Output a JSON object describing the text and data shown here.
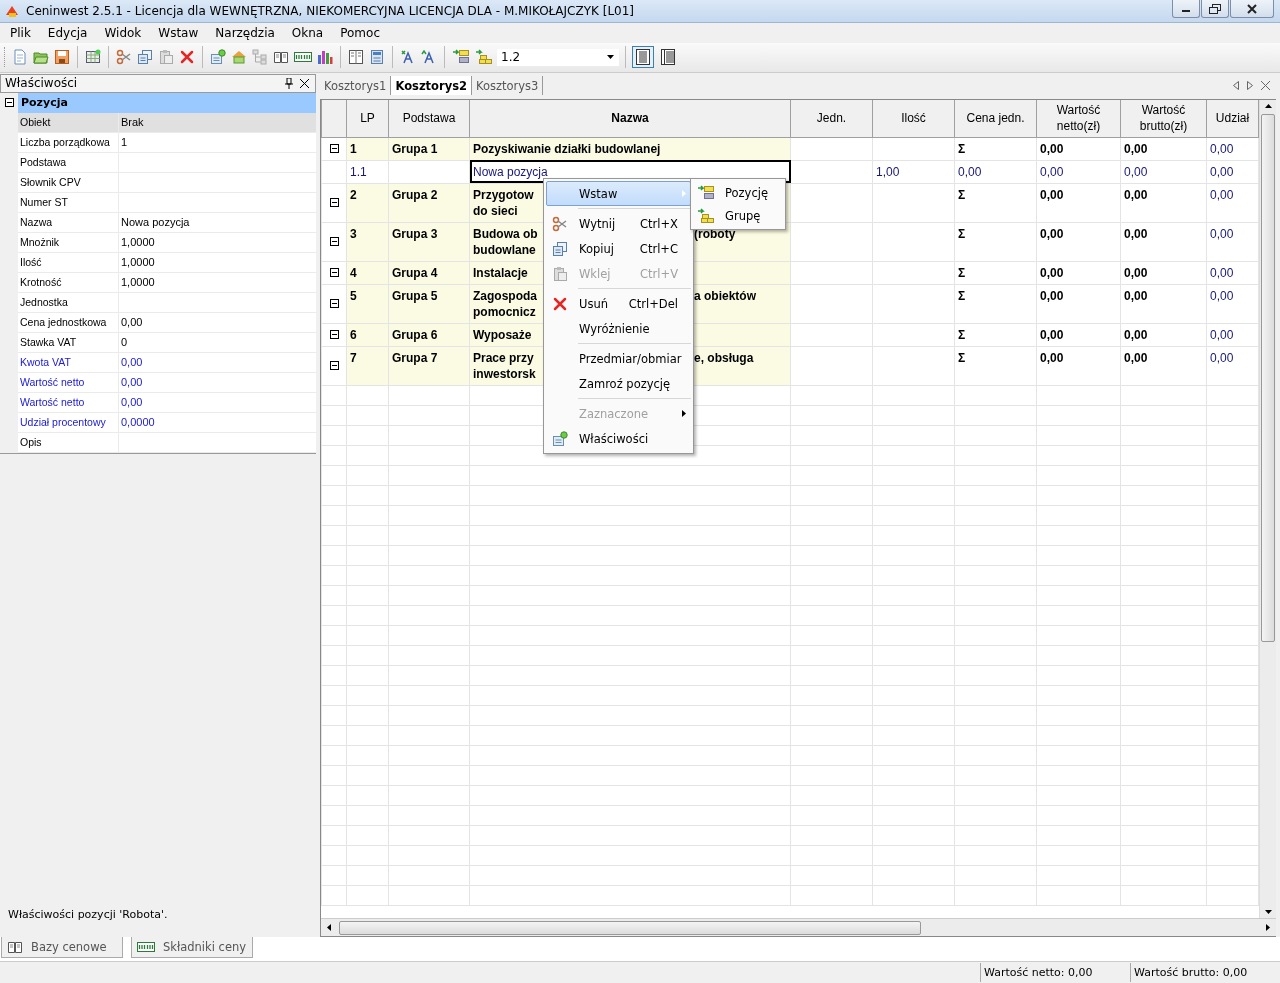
{
  "window": {
    "title": "Ceninwest 2.5.1 - Licencja dla WEWNĘTRZNA, NIEKOMERCYJNA LICENCJA DLA - M.MIKOŁAJCZYK [L01]"
  },
  "menu": [
    "Plik",
    "Edycja",
    "Widok",
    "Wstaw",
    "Narzędzia",
    "Okna",
    "Pomoc"
  ],
  "toolbar": {
    "level_combo": "1.2",
    "view_buttons": [
      {
        "selected": true
      },
      {
        "selected": false
      }
    ]
  },
  "properties_panel": {
    "title": "Właściwości",
    "category": {
      "label": "Pozycja",
      "expanded": true
    },
    "rows": [
      {
        "label": "Obiekt",
        "value": "Brak",
        "selected": true,
        "computed": false
      },
      {
        "label": "Liczba porządkowa",
        "value": "1",
        "selected": false,
        "computed": false
      },
      {
        "label": "Podstawa",
        "selected": false,
        "computed": false
      },
      {
        "label": "Słownik CPV",
        "selected": false,
        "computed": false
      },
      {
        "label": "Numer ST",
        "selected": false,
        "computed": false
      },
      {
        "label": "Nazwa",
        "value": "Nowa pozycja",
        "selected": false,
        "computed": false
      },
      {
        "label": "Mnożnik",
        "value": "1,0000",
        "selected": false,
        "computed": false
      },
      {
        "label": "Ilość",
        "value": "1,0000",
        "selected": false,
        "computed": false
      },
      {
        "label": "Krotność",
        "value": "1,0000",
        "selected": false,
        "computed": false
      },
      {
        "label": "Jednostka",
        "selected": false,
        "computed": false
      },
      {
        "label": "Cena jednostkowa",
        "value": "0,00",
        "selected": false,
        "computed": false
      },
      {
        "label": "Stawka VAT",
        "value": "0",
        "selected": false,
        "computed": false
      },
      {
        "label": "Kwota VAT",
        "value": "0,00",
        "selected": false,
        "computed": true
      },
      {
        "label": "Wartość netto",
        "value": "0,00",
        "selected": false,
        "computed": true
      },
      {
        "label": "Wartość netto",
        "value": "0,00",
        "selected": false,
        "computed": true
      },
      {
        "label": "Udział procentowy",
        "value": "0,0000",
        "selected": false,
        "computed": true
      },
      {
        "label": "Opis",
        "selected": false,
        "computed": false
      }
    ],
    "description": "Właściwości pozycji 'Robota'."
  },
  "document_tabs": [
    {
      "label": "Kosztorys1",
      "selected": false
    },
    {
      "label": "Kosztorys2",
      "selected": true
    },
    {
      "label": "Kosztorys3",
      "selected": false
    }
  ],
  "table": {
    "columns": [
      "LP",
      "Podstawa",
      "Nazwa",
      "Jedn.",
      "Ilość",
      "Cena jedn.",
      "Wartość netto(zł)",
      "Wartość brutto(zł)",
      "Udział"
    ],
    "rows": [
      {
        "kind": "group",
        "expanded": true,
        "focused": false,
        "lp": "1",
        "basis": "Grupa 1",
        "name": [
          "Pozyskiwanie działki budowlanej"
        ],
        "price": "Σ",
        "net": "0,00",
        "gross": "0,00",
        "share": "0,00"
      },
      {
        "kind": "item",
        "focused": true,
        "lp": "1.1",
        "name": [
          "Nowa pozycja"
        ],
        "qty": "1,00",
        "price": "0,00",
        "net": "0,00",
        "gross": "0,00",
        "share": "0,00"
      },
      {
        "kind": "group",
        "expanded": true,
        "focused": false,
        "lp": "2",
        "basis": "Grupa 2",
        "name": [
          "Przygotow",
          "do sieci"
        ],
        "price": "Σ",
        "net": "0,00",
        "gross": "0,00",
        "share": "0,00"
      },
      {
        "kind": "group",
        "expanded": true,
        "focused": false,
        "lp": "3",
        "basis": "Grupa 3",
        "name": [
          "Budowa ob",
          "budowlane"
        ],
        "name_right": "(roboty",
        "price": "Σ",
        "net": "0,00",
        "gross": "0,00",
        "share": "0,00"
      },
      {
        "kind": "group",
        "expanded": true,
        "focused": false,
        "lp": "4",
        "basis": "Grupa 4",
        "name": [
          "Instalacje"
        ],
        "price": "Σ",
        "net": "0,00",
        "gross": "0,00",
        "share": "0,00"
      },
      {
        "kind": "group",
        "expanded": true,
        "focused": false,
        "lp": "5",
        "basis": "Grupa 5",
        "name": [
          "Zagospoda",
          "pomocnicz"
        ],
        "name_right": "a obiektów",
        "price": "Σ",
        "net": "0,00",
        "gross": "0,00",
        "share": "0,00"
      },
      {
        "kind": "group",
        "expanded": true,
        "focused": false,
        "lp": "6",
        "basis": "Grupa 6",
        "name": [
          "Wyposaże"
        ],
        "price": "Σ",
        "net": "0,00",
        "gross": "0,00",
        "share": "0,00"
      },
      {
        "kind": "group",
        "expanded": true,
        "focused": false,
        "lp": "7",
        "basis": "Grupa 7",
        "name": [
          "Prace przy",
          "inwestorsk"
        ],
        "name_right": "e, obsługa",
        "price": "Σ",
        "net": "0,00",
        "gross": "0,00",
        "share": "0,00"
      }
    ]
  },
  "context_menu": {
    "items": [
      {
        "kind": "submenu",
        "label": "Wstaw",
        "selected": true,
        "disabled": false
      },
      {
        "kind": "separator"
      },
      {
        "kind": "item",
        "label": "Wytnij",
        "shortcut": "Ctrl+X",
        "selected": false,
        "disabled": false
      },
      {
        "kind": "item",
        "label": "Kopiuj",
        "shortcut": "Ctrl+C",
        "selected": false,
        "disabled": false
      },
      {
        "kind": "item",
        "label": "Wklej",
        "shortcut": "Ctrl+V",
        "selected": false,
        "disabled": true
      },
      {
        "kind": "separator"
      },
      {
        "kind": "item",
        "label": "Usuń",
        "shortcut": "Ctrl+Del",
        "selected": false,
        "disabled": false
      },
      {
        "kind": "item",
        "label": "Wyróżnienie",
        "selected": false,
        "disabled": false
      },
      {
        "kind": "separator"
      },
      {
        "kind": "item",
        "label": "Przedmiar/obmiar",
        "selected": false,
        "disabled": false
      },
      {
        "kind": "item",
        "label": "Zamroź pozycję",
        "selected": false,
        "disabled": false
      },
      {
        "kind": "separator"
      },
      {
        "kind": "submenu",
        "label": "Zaznaczone",
        "selected": false,
        "disabled": true
      },
      {
        "kind": "item",
        "label": "Właściwości",
        "selected": false,
        "disabled": false
      }
    ]
  },
  "submenu": {
    "items": [
      {
        "label": "Pozycję"
      },
      {
        "label": "Grupę"
      }
    ]
  },
  "bottom_tabs": [
    {
      "label": "Bazy cenowe"
    },
    {
      "label": "Składniki ceny"
    }
  ],
  "status_bar": [
    "Wartość netto: 0,00",
    "Wartość brutto: 0,00"
  ]
}
